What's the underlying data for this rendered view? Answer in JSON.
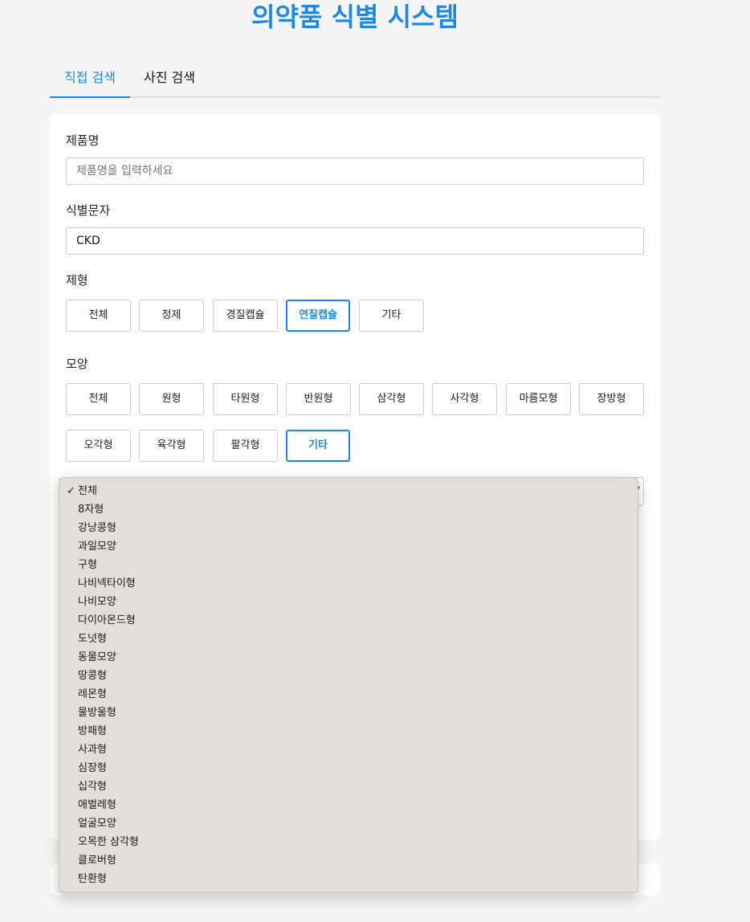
{
  "app_title": "의약품 식별 시스템",
  "tabs": [
    {
      "label": "직접 검색",
      "active": true
    },
    {
      "label": "사진 검색",
      "active": false
    }
  ],
  "form": {
    "product_label": "제품명",
    "product_placeholder": "제품명을 입력하세요",
    "product_value": "",
    "imprint_label": "식별문자",
    "imprint_value": "CKD",
    "dosage_label": "제형",
    "dosage_options": [
      "전체",
      "정제",
      "경질캡슐",
      "연질캡슐",
      "기타"
    ],
    "dosage_selected": "연질캡슐",
    "shape_label": "모양",
    "shape_options_row1": [
      "전체",
      "원형",
      "타원형",
      "반원형",
      "삼각형",
      "사각형",
      "마름모형",
      "장방형"
    ],
    "shape_options_row2": [
      "오각형",
      "육각형",
      "팔각형",
      "기타"
    ],
    "shape_selected": "기타"
  },
  "dropdown": {
    "selected": "전체",
    "check_glyph": "✓",
    "options": [
      "전체",
      "8자형",
      "강낭콩형",
      "과일모양",
      "구형",
      "나비넥타이형",
      "나비모양",
      "다이아몬드형",
      "도넛형",
      "동물모양",
      "땅콩형",
      "레몬형",
      "물방울형",
      "방패형",
      "사과형",
      "심장형",
      "십각형",
      "애벌레형",
      "얼굴모양",
      "오목한 삼각형",
      "클로버형",
      "탄환형"
    ]
  },
  "colors": {
    "accent": "#1e88e5",
    "page_bg": "#f5f5f5",
    "dropdown_bg": "#e1dfdc"
  }
}
